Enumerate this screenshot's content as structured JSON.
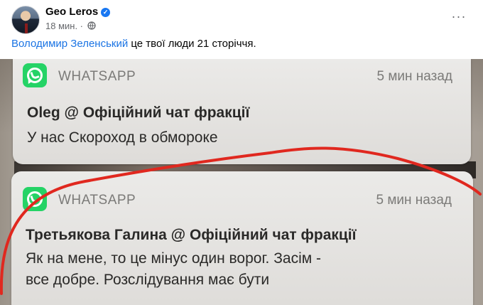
{
  "post": {
    "author": "Geo Leros",
    "time": "18 мин. ·",
    "caption_mention": "Володимир Зеленський",
    "caption_text": " це твої люди 21 сторіччя.",
    "more_label": "···"
  },
  "photo": {
    "notifications": [
      {
        "app": "WHATSAPP",
        "time": "5 мин назад",
        "title": "Oleg @ Офіційний чат фракції",
        "body_lines": [
          "У нас Скороход в обмороке"
        ]
      },
      {
        "app": "WHATSAPP",
        "time": "5 мин назад",
        "title": "Третьякова Галина @ Офіційний чат фракції",
        "body_lines": [
          "Як на мене, то це мінус один ворог. Засім -",
          "все добре. Розслідування має бути"
        ]
      }
    ],
    "scribble_color": "#e0281f"
  },
  "icons": {
    "verified": "verified-badge-icon",
    "privacy": "globe-icon",
    "app": "whatsapp-icon"
  }
}
